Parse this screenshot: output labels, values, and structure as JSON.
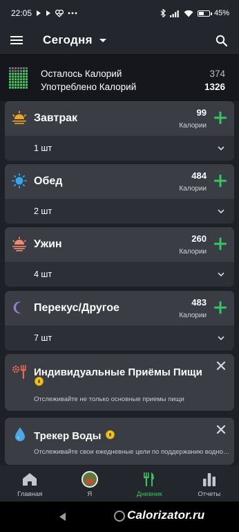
{
  "status_bar": {
    "time": "22:05",
    "battery_text": "45%",
    "battery_level": 0.45,
    "icons": [
      "play-icon",
      "play-icon",
      "heart-monitor-icon",
      "more-dots-icon",
      "bluetooth-icon",
      "signal-icon",
      "wifi-icon",
      "battery-icon"
    ]
  },
  "app_bar": {
    "title": "Сегодня",
    "menu_icon": "hamburger-icon",
    "dropdown_icon": "caret-down-icon",
    "search_icon": "search-icon"
  },
  "summary": {
    "remaining_label": "Осталось Калорий",
    "remaining_value": "374",
    "consumed_label": "Употреблено Калорий",
    "consumed_value": "1326",
    "grid_icon": "calorie-grid-icon",
    "grid_fill_fraction": 0.78
  },
  "meals": [
    {
      "name": "Завтрак",
      "calories": "99",
      "unit": "Калории",
      "items": "1 шт",
      "icon": "sunrise-icon"
    },
    {
      "name": "Обед",
      "calories": "484",
      "unit": "Калории",
      "items": "2 шт",
      "icon": "sun-icon"
    },
    {
      "name": "Ужин",
      "calories": "260",
      "unit": "Калории",
      "items": "4 шт",
      "icon": "sunset-icon"
    },
    {
      "name": "Перекус/Другое",
      "calories": "483",
      "unit": "Калории",
      "items": "7 шт",
      "icon": "moon-icon"
    }
  ],
  "promos": [
    {
      "title": "Индивидуальные Приёмы Пищи",
      "desc": "Отслеживайте не только основные приемы пищи",
      "icon": "fork-knife-gear-icon"
    },
    {
      "title": "Трекер Воды",
      "desc": "Отслеживайте свои ежедневные цели по поддержанию водного баланса",
      "icon": "water-drop-icon"
    }
  ],
  "bottom_nav": [
    {
      "label": "Главная",
      "icon": "home-icon",
      "active": false
    },
    {
      "label": "Я",
      "icon": "avatar",
      "active": false
    },
    {
      "label": "Дневник",
      "icon": "fork-knife-icon",
      "active": true
    },
    {
      "label": "Отчеты",
      "icon": "bar-chart-icon",
      "active": false
    }
  ],
  "watermark": "Calorizator.ru",
  "colors": {
    "accent_green": "#35c65f",
    "sunrise_orange": "#f5a623",
    "sun_blue": "#2ea8f0",
    "sunset_salmon": "#ef8b6a",
    "moon_purple": "#9b7bd4",
    "water_blue": "#4aa8e8",
    "promo_red": "#e86a4f"
  }
}
